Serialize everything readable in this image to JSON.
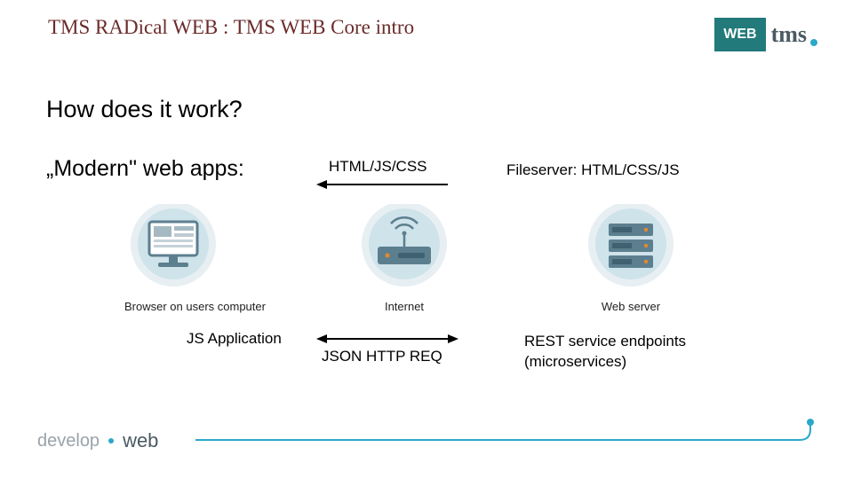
{
  "title": "TMS RADical WEB : TMS WEB Core intro",
  "logo": {
    "web": "WEB",
    "tms": "tms"
  },
  "heading": "How does it work?",
  "subheading": "„Modern\" web apps:",
  "labels": {
    "html_js_css": "HTML/JS/CSS",
    "fileserver": "Fileserver: HTML/CSS/JS",
    "js_application": "JS Application",
    "json_http_req": "JSON HTTP REQ",
    "rest_line1": "REST service endpoints",
    "rest_line2": "(microservices)"
  },
  "icons": {
    "browser_caption": "Browser on users computer",
    "internet_caption": "Internet",
    "server_caption": "Web server"
  },
  "footer": {
    "develop": "develop",
    "web": "web"
  },
  "colors": {
    "teal": "#237a7a",
    "title": "#6b2b2b",
    "cyan": "#2aa8c9",
    "gray": "#9aa3aa",
    "slate": "#4a5a63",
    "iconFill": "#5c7f8f",
    "iconHalo": "#cfe3ea",
    "iconEdge": "#e7eff3"
  }
}
